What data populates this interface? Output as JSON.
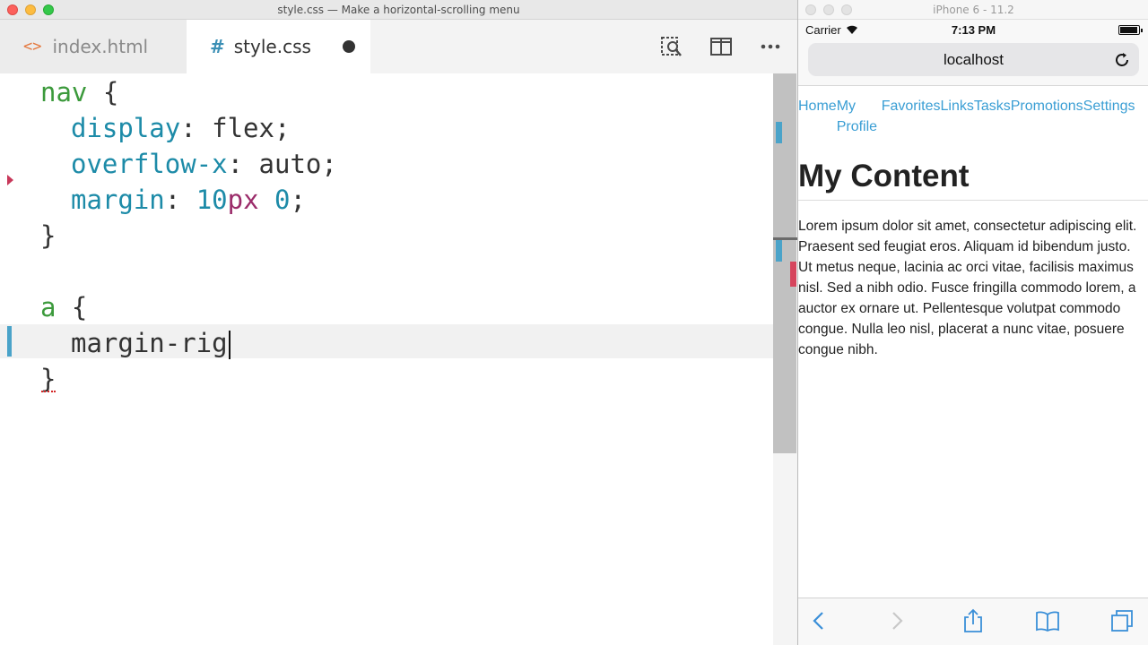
{
  "editor": {
    "window_title": "style.css — Make a horizontal-scrolling menu",
    "tabs": [
      {
        "label": "index.html",
        "icon": "html-code-icon"
      },
      {
        "label": "style.css",
        "icon": "css-hash-icon",
        "modified": true
      }
    ],
    "toolbar_icons": [
      "open-changes-icon",
      "split-editor-icon",
      "more-actions-icon"
    ],
    "code": {
      "l1": {
        "selector": "nav",
        "brace": " {"
      },
      "l2": {
        "prop": "display",
        "colon": ": ",
        "value": "flex",
        "semi": ";"
      },
      "l3": {
        "prop": "overflow-x",
        "colon": ": ",
        "value": "auto",
        "semi": ";"
      },
      "l4": {
        "prop": "margin",
        "colon": ": ",
        "num1": "10",
        "unit1": "px",
        "space": " ",
        "num2": "0",
        "semi": ";"
      },
      "l5": {
        "text": "}"
      },
      "l7": {
        "selector": "a",
        "brace": " {"
      },
      "l8": {
        "prop": "margin-rig"
      },
      "l9": {
        "text": "}"
      }
    }
  },
  "simulator": {
    "window_title": "iPhone 6 - 11.2",
    "carrier": "Carrier",
    "time": "7:13 PM",
    "url": "localhost",
    "nav_links": [
      "Home",
      "My Profile",
      "Favorites",
      "Links",
      "Tasks",
      "Promotions",
      "Settings"
    ],
    "heading": "My Content",
    "paragraph": "Lorem ipsum dolor sit amet, consectetur adipiscing elit. Praesent sed feugiat eros. Aliquam id bibendum justo. Ut metus neque, lacinia ac orci vitae, facilisis maximus nisl. Sed a nibh odio. Fusce fringilla commodo lorem, a auctor ex ornare ut. Pellentesque volutpat commodo congue. Nulla leo nisl, placerat a nunc vitae, posuere congue nibh.",
    "toolbar_icons": [
      "back-icon",
      "forward-icon",
      "share-icon",
      "bookmarks-icon",
      "tabs-icon"
    ]
  },
  "colors": {
    "selector": "#3c9a3c",
    "property": "#1d8ba8",
    "unit": "#9b2c6a",
    "link": "#3a9ed4",
    "ios_tint": "#3a8fd8"
  }
}
